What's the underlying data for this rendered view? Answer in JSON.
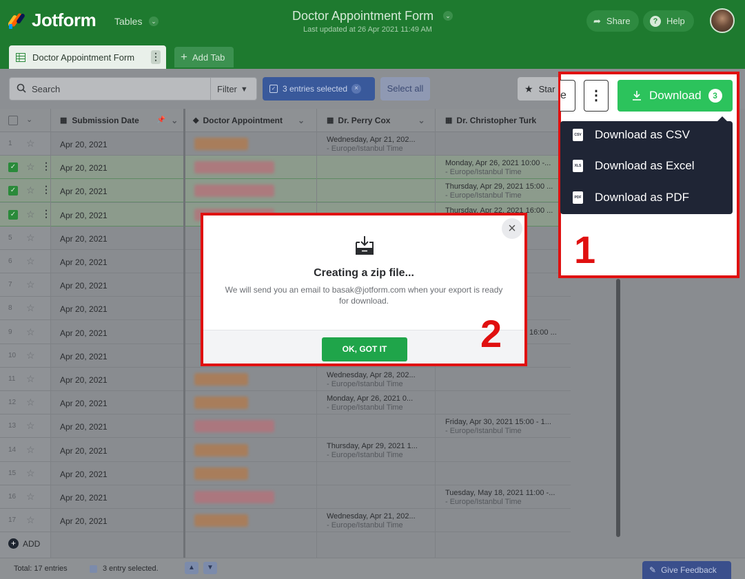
{
  "app": {
    "logo_text": "Jotform",
    "tables_label": "Tables"
  },
  "header": {
    "title": "Doctor Appointment Form",
    "last_updated": "Last updated at 26 Apr 2021 11:49 AM",
    "share_label": "Share",
    "help_label": "Help"
  },
  "tabs": {
    "active_label": "Doctor Appointment Form",
    "add_label": "Add Tab"
  },
  "toolbar": {
    "search_placeholder": "Search",
    "filter_label": "Filter",
    "entries_selected": "3 entries selected",
    "select_all": "Select all",
    "star_label": "Star"
  },
  "columns": [
    "Submission Date",
    "Doctor Appointment",
    "Dr. Perry Cox",
    "Dr. Christopher Turk"
  ],
  "rows": [
    {
      "n": "1",
      "date": "Apr 20, 2021",
      "cox": "Wednesday, Apr 21, 202...",
      "cox_tz": "- Europe/Istanbul Time"
    },
    {
      "n": "2",
      "date": "Apr 20, 2021",
      "turk": "Monday, Apr 26, 2021 10:00 -...",
      "turk_tz": "- Europe/Istanbul Time"
    },
    {
      "n": "3",
      "date": "Apr 20, 2021",
      "turk": "Thursday, Apr 29, 2021 15:00 ...",
      "turk_tz": "- Europe/Istanbul Time"
    },
    {
      "n": "4",
      "date": "Apr 20, 2021",
      "turk": "Thursday, Apr 22, 2021 16:00 ..."
    },
    {
      "n": "5",
      "date": "Apr 20, 2021"
    },
    {
      "n": "6",
      "date": "Apr 20, 2021"
    },
    {
      "n": "7",
      "date": "Apr 20, 2021"
    },
    {
      "n": "8",
      "date": "Apr 20, 2021"
    },
    {
      "n": "9",
      "date": "Apr 20, 2021",
      "turk_frag": "16:00 ..."
    },
    {
      "n": "10",
      "date": "Apr 20, 2021"
    },
    {
      "n": "11",
      "date": "Apr 20, 2021",
      "cox": "Wednesday, Apr 28, 202...",
      "cox_tz": "- Europe/Istanbul Time"
    },
    {
      "n": "12",
      "date": "Apr 20, 2021",
      "cox": "Monday, Apr 26, 2021 0...",
      "cox_tz": "- Europe/Istanbul Time"
    },
    {
      "n": "13",
      "date": "Apr 20, 2021",
      "turk": "Friday, Apr 30, 2021 15:00 - 1...",
      "turk_tz": "- Europe/Istanbul Time"
    },
    {
      "n": "14",
      "date": "Apr 20, 2021",
      "cox": "Thursday, Apr 29, 2021 1...",
      "cox_tz": "- Europe/Istanbul Time"
    },
    {
      "n": "15",
      "date": "Apr 20, 2021"
    },
    {
      "n": "16",
      "date": "Apr 20, 2021",
      "turk": "Tuesday, May 18, 2021 11:00 -...",
      "turk_tz": "- Europe/Istanbul Time"
    },
    {
      "n": "17",
      "date": "Apr 20, 2021",
      "cox": "Wednesday, Apr 21, 202...",
      "cox_tz": "- Europe/Istanbul Time"
    }
  ],
  "grid": {
    "add_label": "ADD"
  },
  "footer": {
    "total": "Total: 17 entries",
    "entry_selected": "3 entry selected.",
    "feedback": "Give Feedback"
  },
  "download": {
    "share_fragment": "e",
    "button_label": "Download",
    "badge": "3",
    "menu": [
      "Download as CSV",
      "Download as Excel",
      "Download as PDF"
    ],
    "file_tags": [
      "CSV",
      "XLS",
      "PDF"
    ],
    "annotation": "1"
  },
  "modal": {
    "title": "Creating a zip file...",
    "body": "We will send you an email to basak@jotform.com when your export is ready for download.",
    "ok_label": "OK, GOT IT",
    "annotation": "2"
  },
  "colors": {
    "brand_green": "#1e7a2f",
    "download_green": "#2cc35c",
    "annotation_red": "#e01010",
    "selection_blue": "#39599b"
  }
}
